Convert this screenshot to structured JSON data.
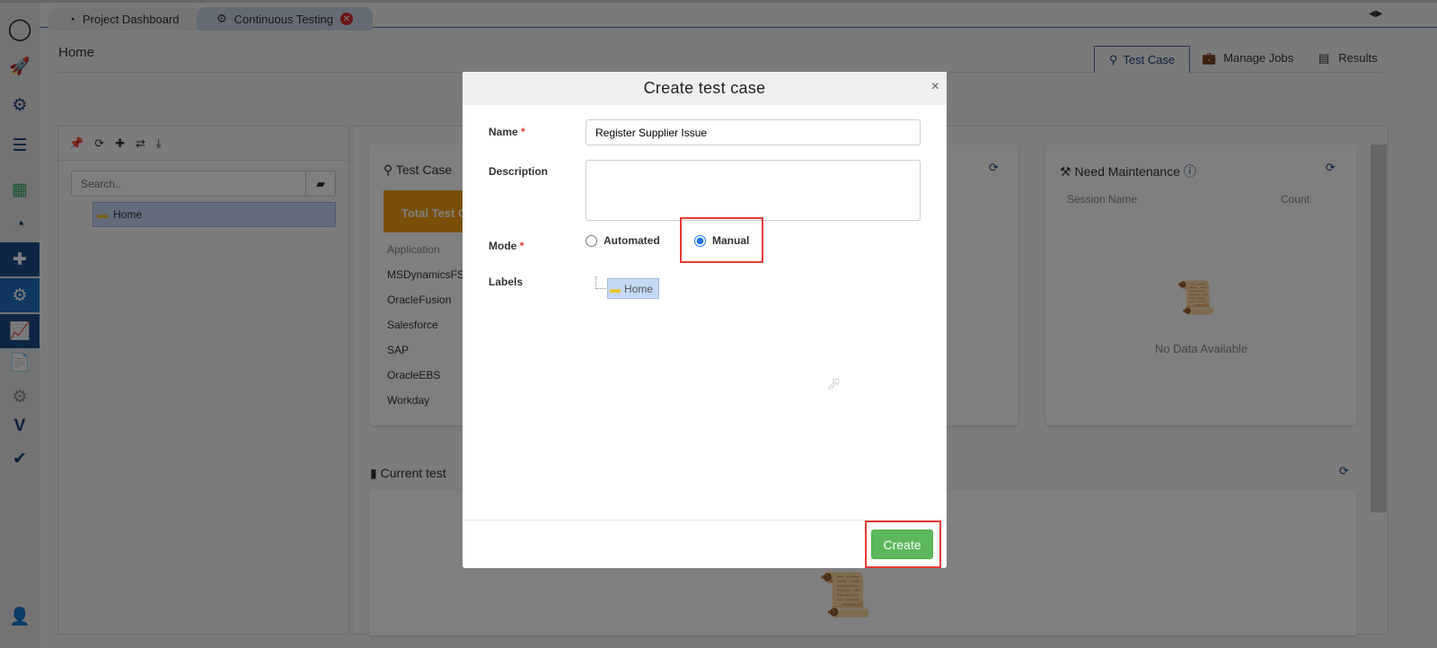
{
  "tabs": [
    {
      "label": "Project Dashboard"
    },
    {
      "label": "Continuous Testing"
    }
  ],
  "page": {
    "title": "Home"
  },
  "view_tabs": [
    {
      "label": "Test Case"
    },
    {
      "label": "Manage Jobs"
    },
    {
      "label": "Results"
    }
  ],
  "tree": {
    "search_placeholder": "Search..",
    "root": "Home"
  },
  "test_case_card": {
    "title": "Test Case",
    "total_label": "Total Test C",
    "column": "Application",
    "apps": [
      "MSDynamicsFS",
      "OracleFusion",
      "Salesforce",
      "SAP",
      "OracleEBS",
      "Workday"
    ]
  },
  "maintenance_card": {
    "title": "Need Maintenance",
    "col1": "Session Name",
    "col2": "Count",
    "empty": "No Data Available"
  },
  "current_section": {
    "title": "Current test"
  },
  "modal": {
    "title": "Create test case",
    "close": "×",
    "name_label": "Name",
    "required": "*",
    "name_value": "Register Supplier Issue",
    "description_label": "Description",
    "description_value": "",
    "mode_label": "Mode",
    "mode_options": [
      "Automated",
      "Manual"
    ],
    "mode_selected": "Manual",
    "labels_label": "Labels",
    "labels_tree_root": "Home",
    "create_label": "Create"
  },
  "colors": {
    "accent": "#1c3f7a",
    "create": "#5cb85c",
    "highlight": "#e53935",
    "total": "#f39c12"
  }
}
